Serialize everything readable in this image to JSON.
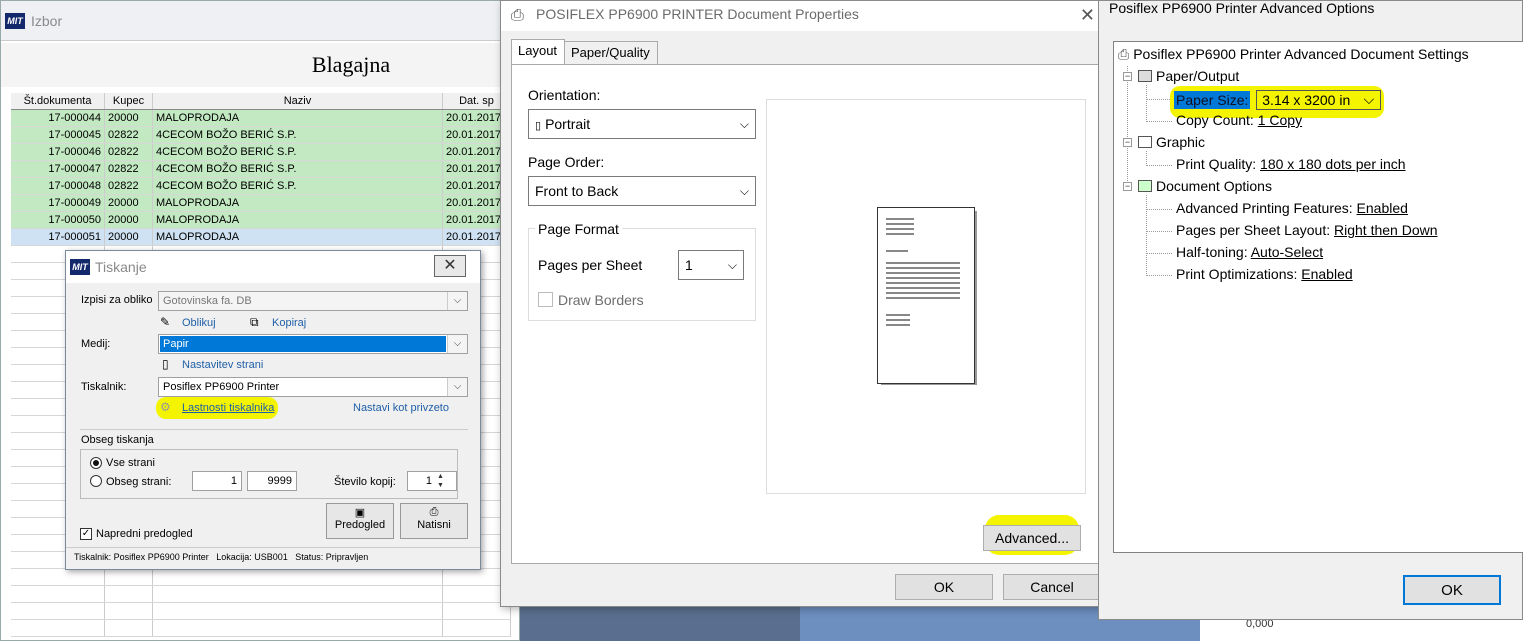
{
  "izbor": {
    "title": "Izbor",
    "logo": "MIT",
    "heading": "Blagajna",
    "columns": [
      "Št.dokumenta",
      "Kupec",
      "Naziv",
      "Dat. sp"
    ],
    "rows": [
      [
        "17-000044",
        "20000",
        "MALOPRODAJA",
        "20.01.2017"
      ],
      [
        "17-000045",
        "02822",
        "4CECOM BOŽO BERIĆ S.P.",
        "20.01.2017"
      ],
      [
        "17-000046",
        "02822",
        "4CECOM BOŽO BERIĆ S.P.",
        "20.01.2017"
      ],
      [
        "17-000047",
        "02822",
        "4CECOM BOŽO BERIĆ S.P.",
        "20.01.2017"
      ],
      [
        "17-000048",
        "02822",
        "4CECOM BOŽO BERIĆ S.P.",
        "20.01.2017"
      ],
      [
        "17-000049",
        "20000",
        "MALOPRODAJA",
        "20.01.2017"
      ],
      [
        "17-000050",
        "20000",
        "MALOPRODAJA",
        "20.01.2017"
      ],
      [
        "17-000051",
        "20000",
        "MALOPRODAJA",
        "20.01.2017"
      ]
    ],
    "bottom_value": "0,000"
  },
  "tiskanje": {
    "title": "Tiskanje",
    "izpisi_label": "Izpisi za obliko",
    "izpisi_value": "Gotovinska fa. DB",
    "oblikuj": "Oblikuj",
    "kopiraj": "Kopiraj",
    "medij_label": "Medij:",
    "medij_value": "Papir",
    "nastavitev": "Nastavitev strani",
    "tiskalnik_label": "Tiskalnik:",
    "tiskalnik_value": "Posiflex PP6900 Printer",
    "lastnosti": "Lastnosti tiskalnika",
    "nastavi": "Nastavi kot privzeto",
    "obseg_title": "Obseg tiskanja",
    "vse_strani": "Vse strani",
    "obseg_strani": "Obseg strani:",
    "from": "1",
    "to": "9999",
    "stevilo_label": "Število kopij:",
    "stevilo_value": "1",
    "napredni": "Napredni predogled",
    "predogled": "Predogled",
    "natisni": "Natisni",
    "status_bar": "Tiskalnik: Posiflex PP6900 Printer   Lokacija: USB001   Status: Pripravljen"
  },
  "docprops": {
    "title": "POSIFLEX PP6900 PRINTER Document Properties",
    "tabs": [
      "Layout",
      "Paper/Quality"
    ],
    "orientation_label": "Orientation:",
    "orientation_value": "Portrait",
    "page_order_label": "Page Order:",
    "page_order_value": "Front to Back",
    "page_format_title": "Page Format",
    "pages_per_sheet_label": "Pages per Sheet",
    "pages_per_sheet_value": "1",
    "draw_borders": "Draw Borders",
    "advanced": "Advanced...",
    "ok": "OK",
    "cancel": "Cancel"
  },
  "advanced": {
    "title": "Posiflex PP6900 Printer Advanced Options",
    "root": "Posiflex PP6900 Printer Advanced Document Settings",
    "paper_output": "Paper/Output",
    "paper_size_label": "Paper Size:",
    "paper_size_value": "3.14 x 3200 in",
    "copy_count_label": "Copy Count:",
    "copy_count_value": "1 Copy",
    "graphic": "Graphic",
    "print_quality_label": "Print Quality:",
    "print_quality_value": "180 x 180 dots per inch",
    "document_options": "Document Options",
    "apf_label": "Advanced Printing Features:",
    "apf_value": "Enabled",
    "psl_label": "Pages per Sheet Layout:",
    "psl_value": "Right then Down",
    "ht_label": "Half-toning:",
    "ht_value": "Auto-Select",
    "po_label": "Print Optimizations:",
    "po_value": "Enabled",
    "ok": "OK"
  }
}
